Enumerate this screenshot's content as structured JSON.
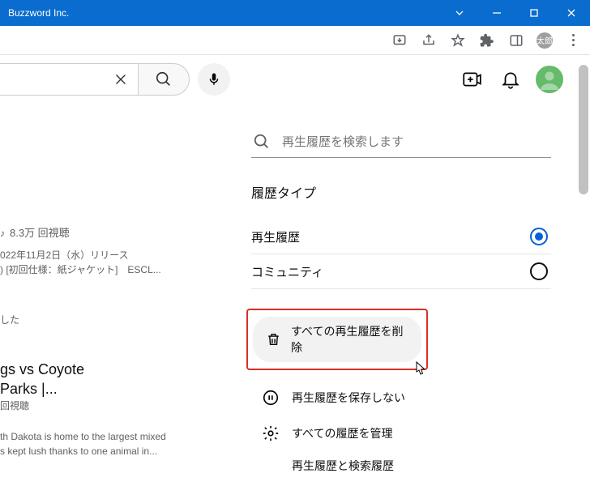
{
  "titlebar": {
    "title": "Buzzword Inc."
  },
  "browser": {
    "avatar_text": "太郎"
  },
  "left": {
    "music_views": "8.3万 回視聴",
    "release": "022年11月2日（水）リリース",
    "edition": ") [初回仕様：紙ジャケット]　ESCL...",
    "rec_label": "した",
    "vid_title1": "gs vs Coyote",
    "vid_title2": "Parks |...",
    "vid_views": "回視聴",
    "vid_desc1": "th Dakota is home to the largest mixed",
    "vid_desc2": "s kept lush thanks to one animal in..."
  },
  "right": {
    "search_placeholder": "再生履歴を検索します",
    "section_title": "履歴タイプ",
    "opt_play": "再生履歴",
    "opt_community": "コミュニティ",
    "delete_all": "すべての再生履歴を削除",
    "pause_hist": "再生履歴を保存しない",
    "manage_all": "すべての履歴を管理",
    "subtext": "再生履歴と検索履歴"
  }
}
